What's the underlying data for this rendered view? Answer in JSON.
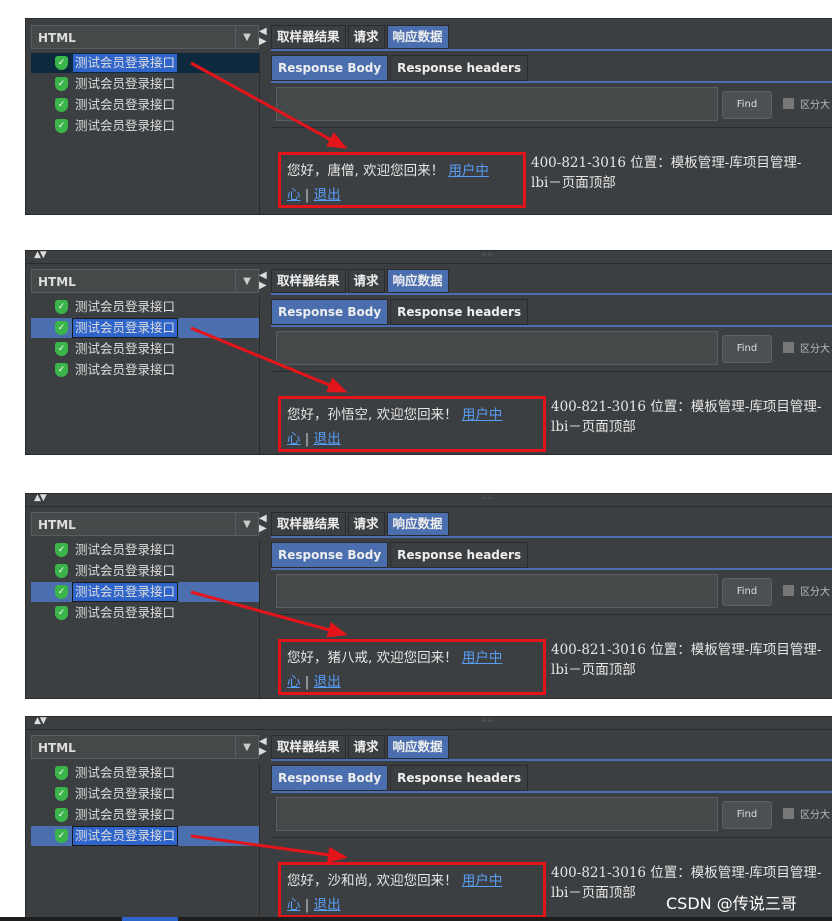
{
  "combo_value": "HTML",
  "tabs": [
    "取样器结果",
    "请求",
    "响应数据"
  ],
  "active_tab": 2,
  "subtabs": [
    "Response Body",
    "Response headers"
  ],
  "find_label": "Find",
  "checkbox_label": "区分大",
  "tree_item_label": "测试会员登录接口",
  "greeting_prefix": "您好，",
  "greeting_suffix": ", 欢迎您回来！ ",
  "link_user_center_a": "用户中",
  "link_user_center_b": "心",
  "separator": " | ",
  "link_logout": "退出",
  "side_text_line1": "400-821-3016 位置：模板管理-库项目管理-",
  "side_text_line2": "lbi－页面顶部",
  "topbar_arrows": "▲▼",
  "topbar_grip": "⁘⁘",
  "panels": [
    {
      "selected": 0,
      "user": "唐僧",
      "has_topbar": false
    },
    {
      "selected": 1,
      "user": "孙悟空",
      "has_topbar": true
    },
    {
      "selected": 2,
      "user": "猪八戒",
      "has_topbar": true
    },
    {
      "selected": 3,
      "user": "沙和尚",
      "has_topbar": true
    }
  ],
  "watermark": "CSDN @传说三哥",
  "colors": {
    "accent": "#4b6eaf",
    "highlight_box": "#e3151b",
    "link": "#589df6",
    "success_icon": "#3bb54a"
  }
}
